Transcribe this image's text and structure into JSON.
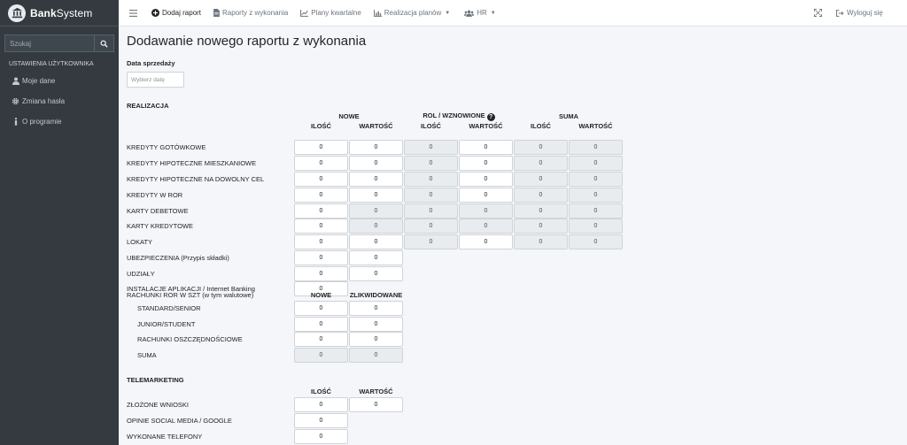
{
  "brand": {
    "name_bold": "Bank",
    "name_light": "System"
  },
  "sidebar": {
    "search_placeholder": "Szukaj",
    "section_header": "USTAWIENIA UŻYTKOWNIKA",
    "items": [
      {
        "label": "Moje dane",
        "icon": "user-icon"
      },
      {
        "label": "Zmiana hasła",
        "icon": "gear-icon"
      },
      {
        "label": "O programie",
        "icon": "info-icon"
      }
    ]
  },
  "topnav": {
    "items": [
      {
        "label": "Dodaj raport",
        "icon": "plus-circle-icon"
      },
      {
        "label": "Raporty z wykonania",
        "icon": "file-icon"
      },
      {
        "label": "Plany kwartalne",
        "icon": "chart-line-icon"
      },
      {
        "label": "Realizacja planów",
        "icon": "chart-bar-icon"
      },
      {
        "label": "HR",
        "icon": "users-icon"
      }
    ],
    "logout": "Wyloguj się"
  },
  "page": {
    "title": "Dodawanie nowego raportu z wykonania",
    "date_label": "Data sprzedaży",
    "date_placeholder": "Wybierz datę"
  },
  "realizacja": {
    "title": "REALIZACJA",
    "groups": [
      "NOWE",
      "ROL / WZNOWIONE",
      "SUMA"
    ],
    "subheads": [
      "ILOŚĆ",
      "WARTOŚĆ",
      "ILOŚĆ",
      "WARTOŚĆ",
      "ILOŚĆ",
      "WARTOŚĆ"
    ],
    "rows": [
      {
        "label": "KREDYTY GOTÓWKOWE",
        "values": [
          "0",
          "0",
          "0",
          "0",
          "0",
          "0"
        ]
      },
      {
        "label": "KREDYTY HIPOTECZNE MIESZKANIOWE",
        "values": [
          "0",
          "0",
          "0",
          "0",
          "0",
          "0"
        ]
      },
      {
        "label": "KREDYTY HIPOTECZNE NA DOWOLNY CEL",
        "values": [
          "0",
          "0",
          "0",
          "0",
          "0",
          "0"
        ]
      },
      {
        "label": "KREDYTY W ROR",
        "values": [
          "0",
          "0",
          "0",
          "0",
          "0",
          "0"
        ]
      },
      {
        "label": "KARTY DEBETOWE",
        "values": [
          "0",
          "0",
          "0",
          "0",
          "0",
          "0"
        ]
      },
      {
        "label": "KARTY KREDYTOWE",
        "values": [
          "0",
          "0",
          "0",
          "0",
          "0",
          "0"
        ]
      },
      {
        "label": "LOKATY",
        "values": [
          "0",
          "0",
          "0",
          "0",
          "0",
          "0"
        ]
      },
      {
        "label": "UBEZPIECZENIA (Przypis składki)",
        "values": [
          "0",
          "0"
        ]
      },
      {
        "label": "UDZIAŁY",
        "values": [
          "0",
          "0"
        ]
      },
      {
        "label": "INSTALACJE APLIKACJI / Internet Banking",
        "values": [
          "0"
        ]
      }
    ],
    "ror": {
      "label": "RACHUNKI ROR W SZT (w tym walutowe)",
      "heads": [
        "NOWE",
        "ZLIKWIDOWANE"
      ],
      "rows": [
        {
          "label": "STANDARD/SENIOR",
          "values": [
            "0",
            "0"
          ]
        },
        {
          "label": "JUNIOR/STUDENT",
          "values": [
            "0",
            "0"
          ]
        },
        {
          "label": "RACHUNKI OSZCZĘDNOŚCIOWE",
          "values": [
            "0",
            "0"
          ]
        },
        {
          "label": "SUMA",
          "values": [
            "0",
            "0"
          ]
        }
      ]
    }
  },
  "telemarketing": {
    "title": "TELEMARKETING",
    "heads": [
      "ILOŚĆ",
      "WARTOŚĆ"
    ],
    "rows": [
      {
        "label": "ZŁOŻONE WNIOSKI",
        "values": [
          "0",
          "0"
        ]
      },
      {
        "label": "OPINIE SOCIAL MEDIA / GOOGLE",
        "values": [
          "0"
        ]
      },
      {
        "label": "WYKONANE TELEFONY",
        "values": [
          "0"
        ]
      }
    ]
  },
  "colors": {
    "sidebar_bg": "#343a40",
    "readonly_bg": "#e9ecef"
  }
}
